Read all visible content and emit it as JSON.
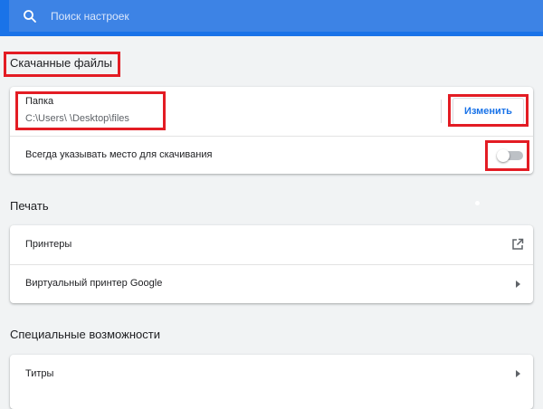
{
  "search": {
    "placeholder": "Поиск настроек",
    "icon": "search-icon"
  },
  "downloads": {
    "title": "Скачанные файлы",
    "folder_label": "Папка",
    "folder_path": "C:\\Users\\      \\Desktop\\files",
    "change_button": "Изменить",
    "ask_location_label": "Всегда указывать место для скачивания",
    "ask_location_enabled": false
  },
  "printing": {
    "title": "Печать",
    "items": [
      {
        "label": "Принтеры",
        "icon": "external-link-icon"
      },
      {
        "label": "Виртуальный принтер Google",
        "icon": "arrow-right-icon"
      }
    ]
  },
  "accessibility": {
    "title": "Специальные возможности",
    "items": [
      {
        "label": "Титры",
        "icon": "arrow-right-icon"
      }
    ]
  },
  "colors": {
    "accent": "#1a73e8",
    "highlight": "#e31c24",
    "background": "#f1f3f4"
  }
}
